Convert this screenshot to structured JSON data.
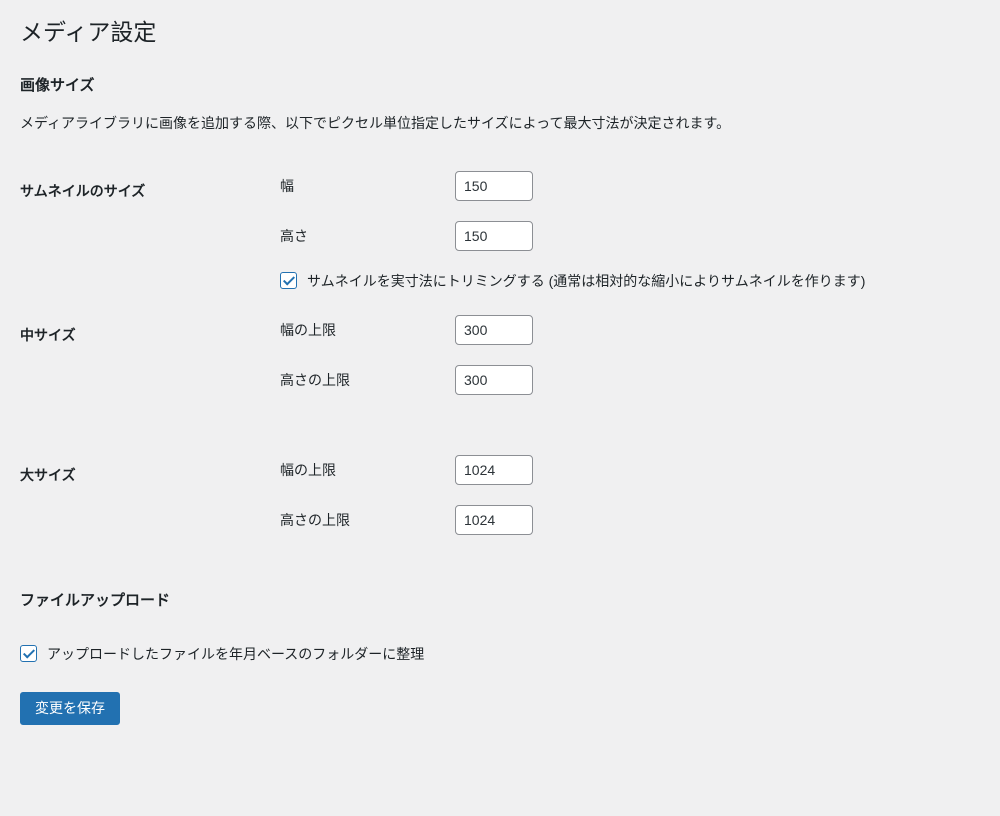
{
  "page": {
    "title": "メディア設定"
  },
  "image_sizes": {
    "heading": "画像サイズ",
    "description": "メディアライブラリに画像を追加する際、以下でピクセル単位指定したサイズによって最大寸法が決定されます。"
  },
  "thumbnail": {
    "label": "サムネイルのサイズ",
    "width_label": "幅",
    "width_value": "150",
    "height_label": "高さ",
    "height_value": "150",
    "crop_checked": true,
    "crop_label": "サムネイルを実寸法にトリミングする (通常は相対的な縮小によりサムネイルを作ります)"
  },
  "medium": {
    "label": "中サイズ",
    "width_label": "幅の上限",
    "width_value": "300",
    "height_label": "高さの上限",
    "height_value": "300"
  },
  "large": {
    "label": "大サイズ",
    "width_label": "幅の上限",
    "width_value": "1024",
    "height_label": "高さの上限",
    "height_value": "1024"
  },
  "upload": {
    "heading": "ファイルアップロード",
    "organize_checked": true,
    "organize_label": "アップロードしたファイルを年月ベースのフォルダーに整理"
  },
  "submit": {
    "label": "変更を保存"
  }
}
